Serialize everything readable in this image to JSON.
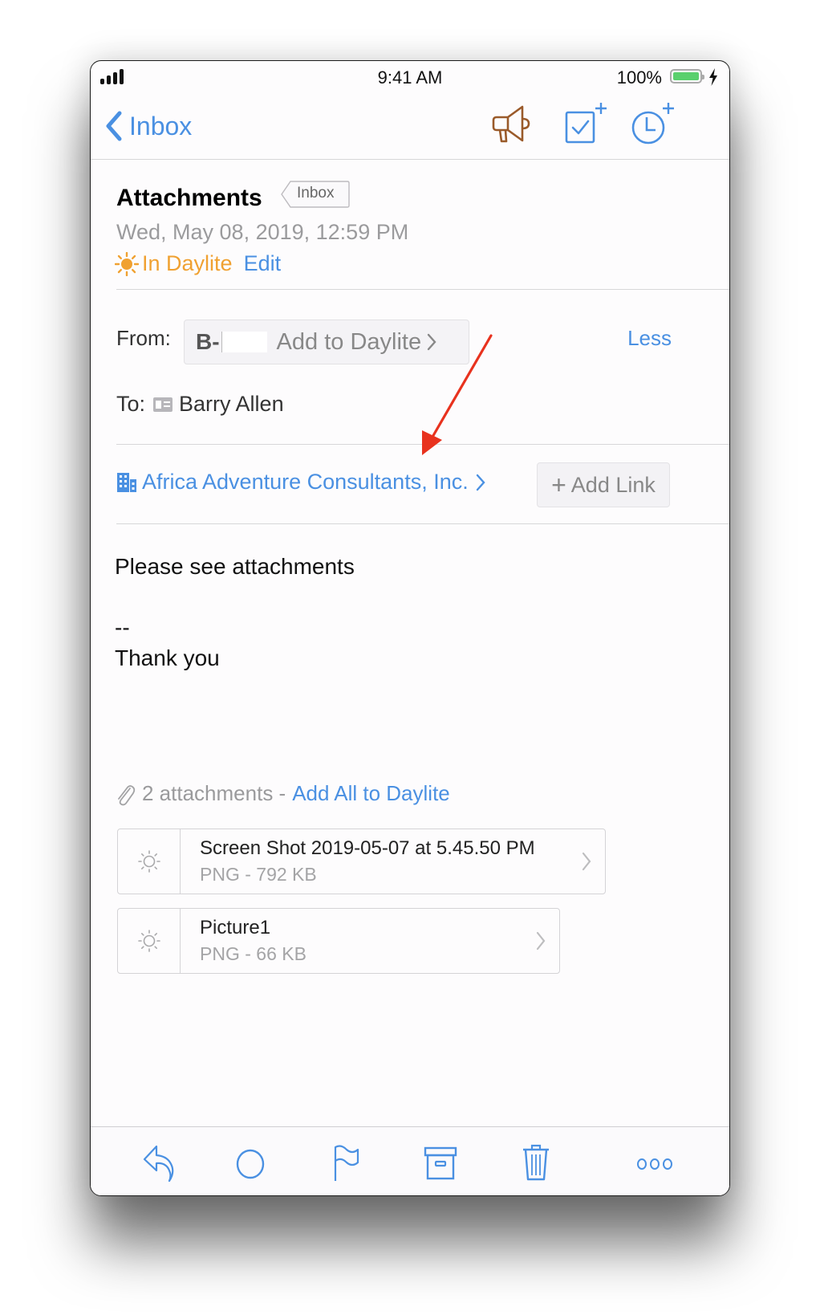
{
  "status_bar": {
    "time": "9:41 AM",
    "battery_percent": "100%",
    "battery_level": 1.0,
    "signal_icon": "cellular-signal-icon",
    "charging_icon": "bolt-icon"
  },
  "nav": {
    "back_label": "Inbox",
    "actions": [
      {
        "name": "announce",
        "icon": "megaphone-icon"
      },
      {
        "name": "add-task",
        "icon": "task-checkbox-plus-icon"
      },
      {
        "name": "add-appointment",
        "icon": "clock-plus-icon"
      }
    ]
  },
  "message": {
    "subject": "Attachments",
    "mailbox_tag": "Inbox",
    "date": "Wed, May 08, 2019, 12:59 PM",
    "daylite_status": "In Daylite",
    "edit_label": "Edit",
    "from_label": "From:",
    "from_name": "B-",
    "from_action": "Add to Daylite",
    "less_label": "Less",
    "to_label": "To:",
    "to_name": "Barry Allen",
    "linked_company": "Africa Adventure Consultants, Inc.",
    "add_link_label": "Add Link",
    "body_lines": [
      "Please see attachments",
      "--",
      "Thank you"
    ]
  },
  "attachments": {
    "summary": "2 attachments -",
    "add_all_label": "Add All to Daylite",
    "items": [
      {
        "name": "Screen Shot 2019-05-07 at 5.45.50 PM",
        "meta": "PNG - 792 KB"
      },
      {
        "name": "Picture1",
        "meta": "PNG - 66 KB"
      }
    ]
  },
  "toolbar": {
    "items": [
      {
        "name": "reply",
        "icon": "reply-icon"
      },
      {
        "name": "mark-unread",
        "icon": "circle-icon"
      },
      {
        "name": "flag",
        "icon": "flag-icon"
      },
      {
        "name": "archive",
        "icon": "archive-box-icon"
      },
      {
        "name": "trash",
        "icon": "trash-icon"
      },
      {
        "name": "more",
        "icon": "ellipsis-icon"
      }
    ]
  },
  "colors": {
    "accent": "#4a90e2",
    "daylite_orange": "#f0a131",
    "megaphone_brown": "#9a5a2a",
    "annotation_red": "#e8321e",
    "battery_green": "#5ad06d"
  }
}
